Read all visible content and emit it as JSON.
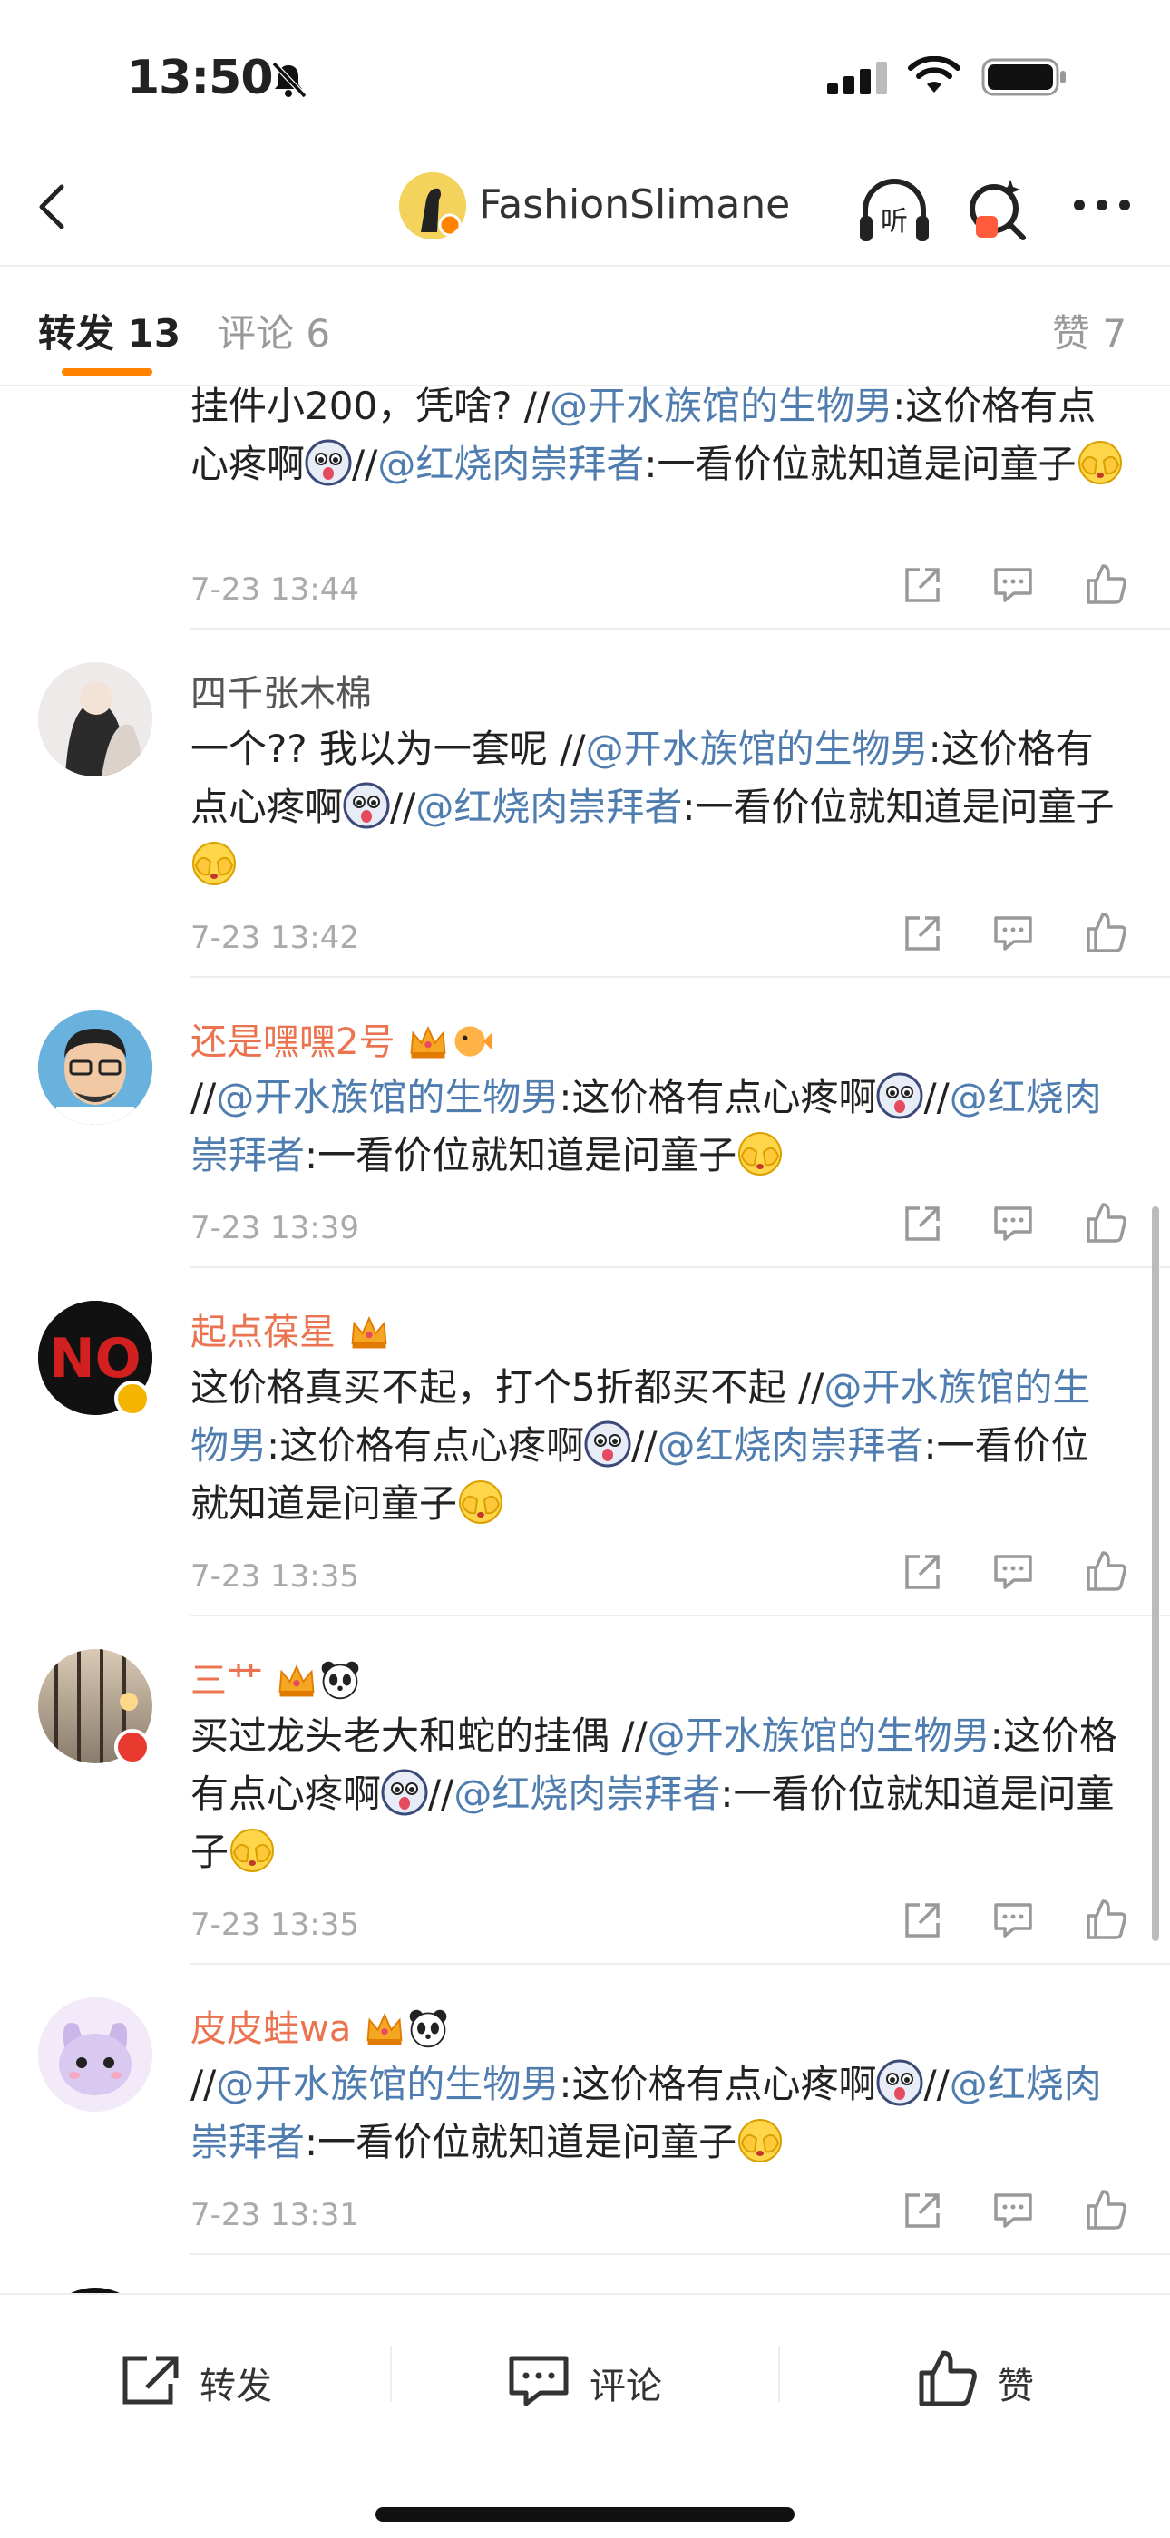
{
  "status_bar": {
    "time": "13:50"
  },
  "nav": {
    "title": "FashionSlimane",
    "listen_label": "听"
  },
  "tabs": {
    "repost": "转发 13",
    "comment": "评论 6",
    "like": "赞 7"
  },
  "feed": {
    "items": [
      {
        "name": "",
        "text_parts": [
          "挂件小200，凭啥? //",
          "@开水族馆的生物男",
          ":这价格有点心疼啊",
          "[emoji]",
          "//",
          "@红烧肉崇拜者",
          ":一看价位就知道是问童子",
          "[emoji]"
        ],
        "time": "7-23 13:44"
      },
      {
        "name": "四千张木棉",
        "text_parts": [
          "一个?? 我以为一套呢 //",
          "@开水族馆的生物男",
          ":这价格有点心疼啊",
          "[emoji]",
          "//",
          "@红烧肉崇拜者",
          ":一看价位就知道是问童子",
          "[emoji]"
        ],
        "time": "7-23 13:42"
      },
      {
        "name": "还是嘿嘿2号",
        "text_parts": [
          "//",
          "@开水族馆的生物男",
          ":这价格有点心疼啊",
          "[emoji]",
          "//",
          "@红烧肉崇拜者",
          ":一看价位就知道是问童子",
          "[emoji]"
        ],
        "time": "7-23 13:39"
      },
      {
        "name": "起点葆星",
        "text_parts": [
          "这价格真买不起，打个5折都买不起 //",
          "@开水族馆的生物男",
          ":这价格有点心疼啊",
          "[emoji]",
          "//",
          "@红烧肉崇拜者",
          ":一看价位就知道是问童子",
          "[emoji]"
        ],
        "time": "7-23 13:35"
      },
      {
        "name": "三艹",
        "text_parts": [
          "买过龙头老大和蛇的挂偶 //",
          "@开水族馆的生物男",
          ":这价格有点心疼啊",
          "[emoji]",
          "//",
          "@红烧肉崇拜者",
          ":一看价位就知道是问童子",
          "[emoji]"
        ],
        "time": "7-23 13:35"
      },
      {
        "name": "皮皮蛙wa",
        "text_parts": [
          "//",
          "@开水族馆的生物男",
          ":这价格有点心疼啊",
          "[emoji]",
          "//",
          "@红烧肉崇拜者",
          ":一看价位就知道是问童子",
          "[emoji]"
        ],
        "time": "7-23 13:31"
      }
    ]
  },
  "bottom_bar": {
    "repost": "转发",
    "comment": "评论",
    "like": "赞"
  },
  "colors": {
    "accent": "#ff8200",
    "mention": "#507daf",
    "vip_name": "#eb7350"
  },
  "icons": [
    "back-arrow-icon",
    "listen-icon",
    "ai-search-icon",
    "more-icon",
    "repost-icon",
    "comment-icon",
    "like-icon"
  ]
}
